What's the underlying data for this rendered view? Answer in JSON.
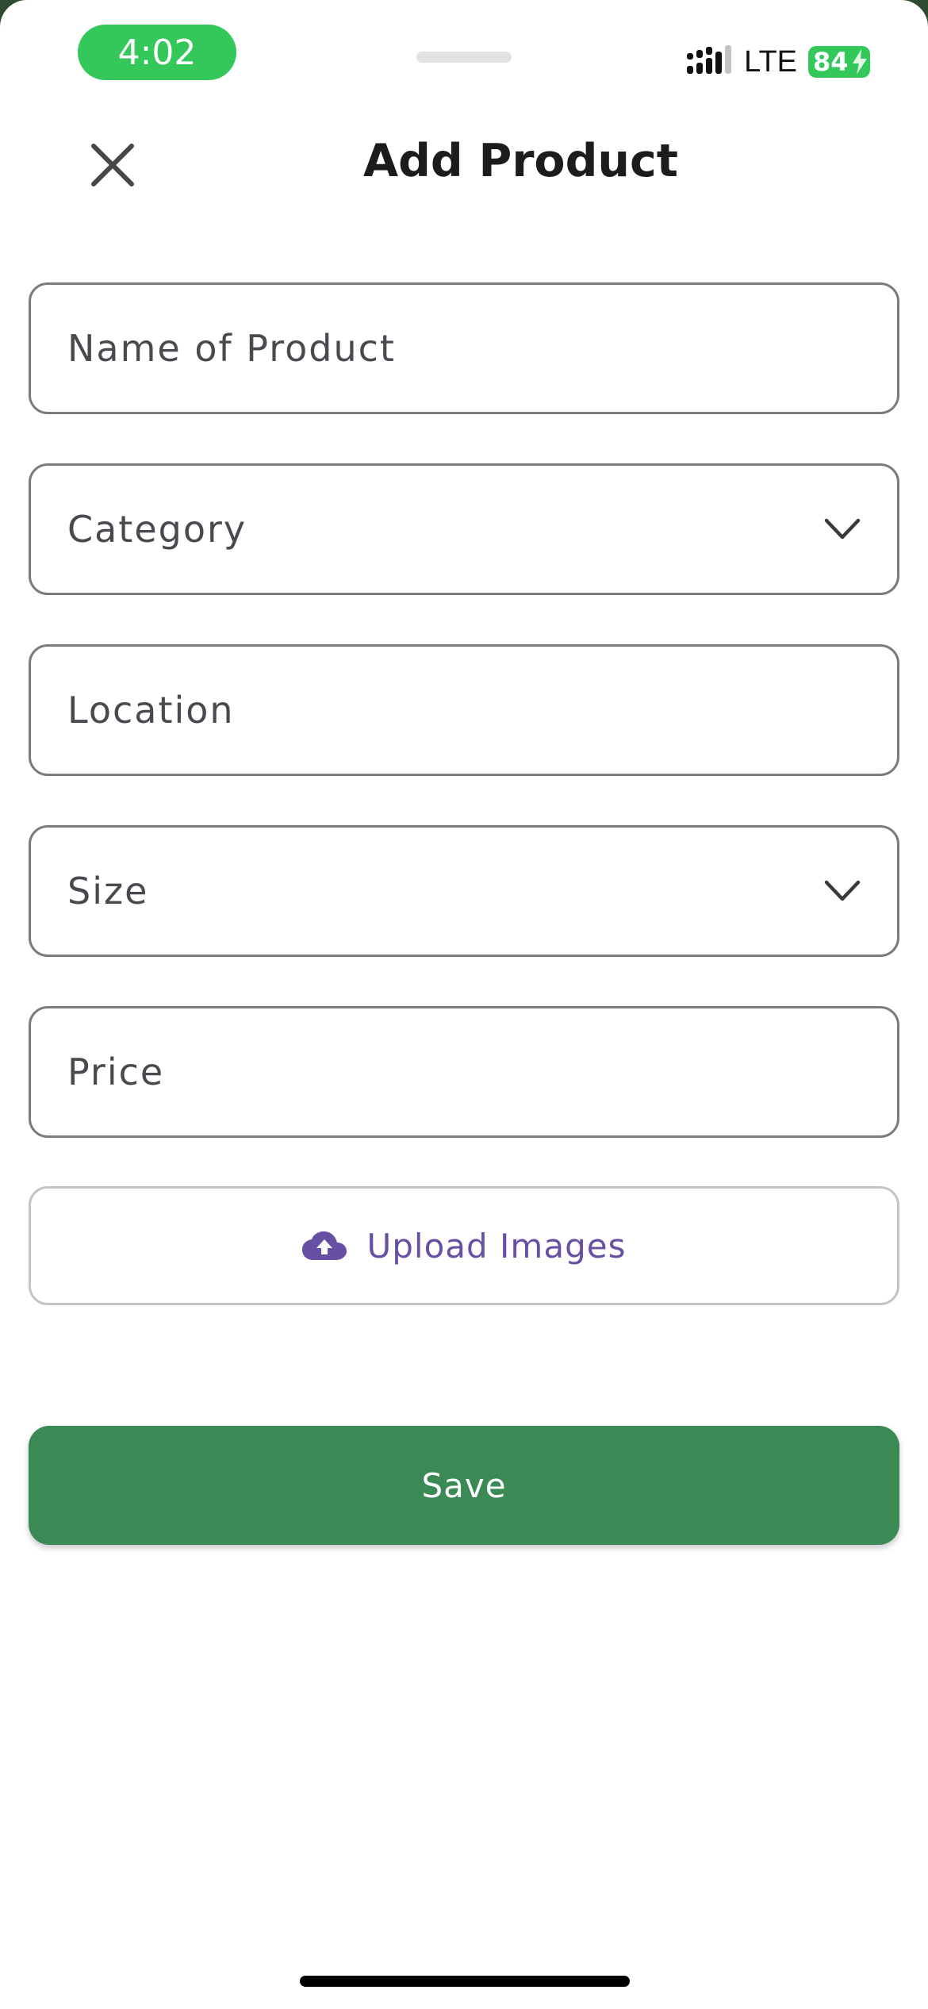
{
  "status_bar": {
    "time": "4:02",
    "network": "LTE",
    "battery_percent": "84",
    "battery_color": "#34c759"
  },
  "header": {
    "title": "Add Product",
    "close_icon": "close-icon"
  },
  "form": {
    "name_placeholder": "Name of Product",
    "category_placeholder": "Category",
    "location_placeholder": "Location",
    "size_placeholder": "Size",
    "price_placeholder": "Price",
    "upload_label": "Upload Images",
    "upload_icon": "cloud-upload-icon",
    "save_label": "Save"
  },
  "colors": {
    "accent_purple": "#6750a4",
    "save_green": "#3b8a55"
  }
}
